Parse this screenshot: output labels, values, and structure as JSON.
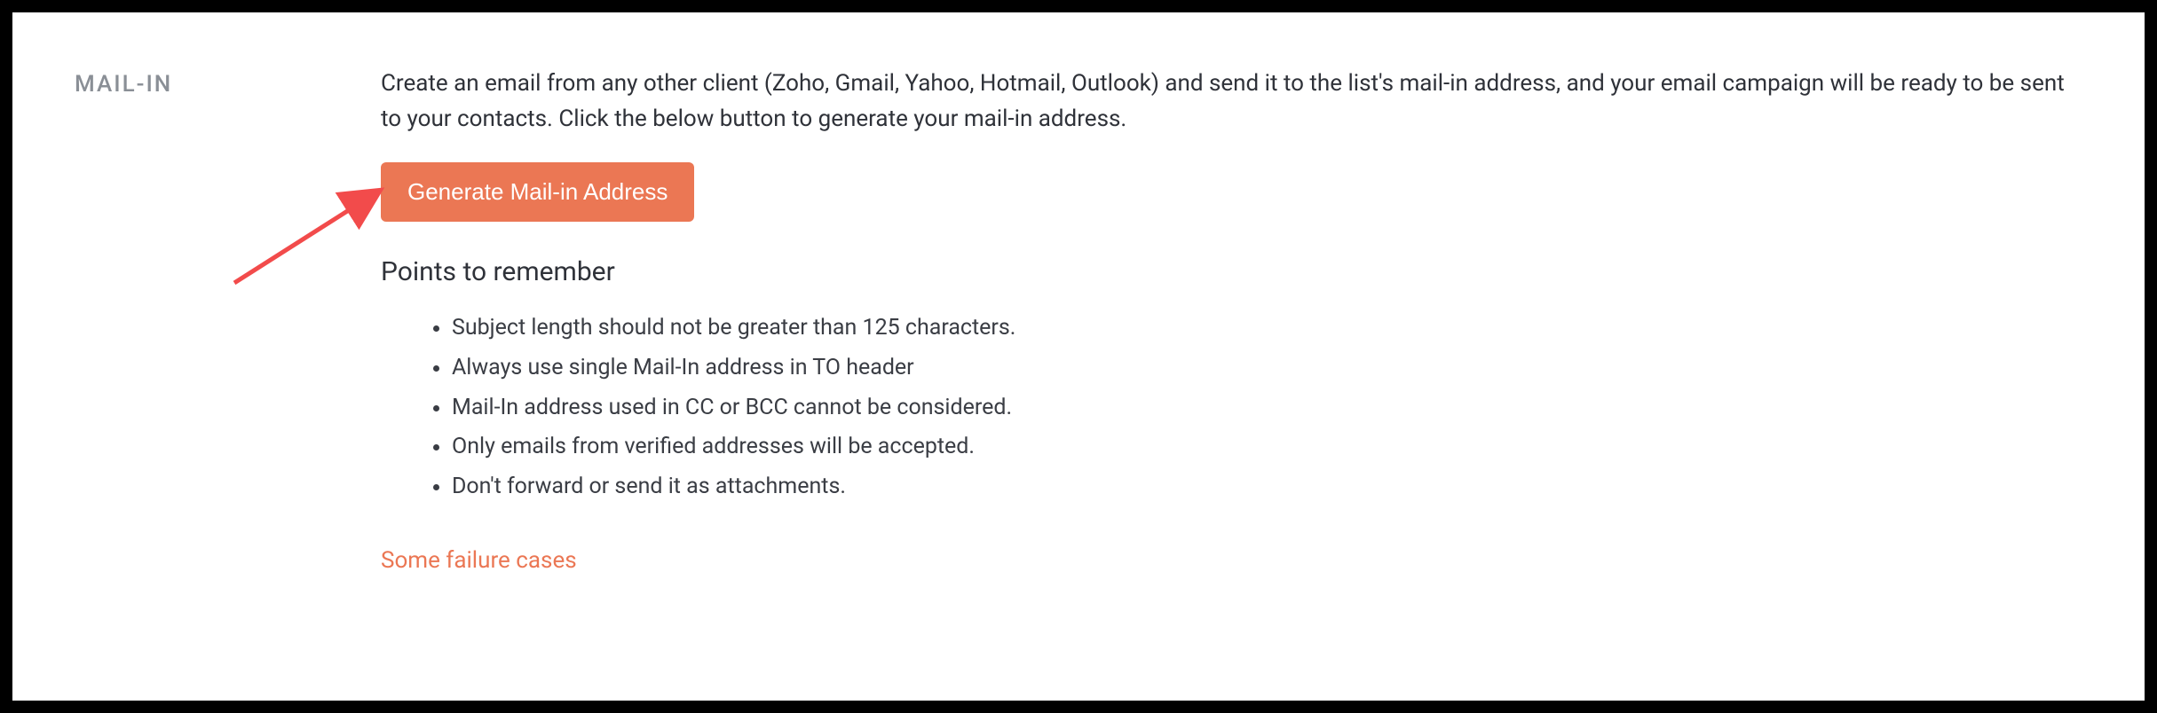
{
  "section_label": "MAIL-IN",
  "description": "Create an email from any other client (Zoho, Gmail, Yahoo, Hotmail, Outlook) and send it to the list's mail-in address, and your email campaign will be ready to be sent to your contacts. Click the below button to generate your mail-in address.",
  "button_label": "Generate Mail-in Address",
  "points_heading": "Points to remember",
  "points": [
    "Subject length should not be greater than 125 characters.",
    "Always use single Mail-In address in TO header",
    "Mail-In address used in CC or BCC cannot be considered.",
    "Only emails from verified addresses will be accepted.",
    "Don't forward or send it as attachments."
  ],
  "failure_link": "Some failure cases",
  "colors": {
    "accent": "#EB7754",
    "muted": "#8A8F96",
    "text": "#2F3239"
  }
}
